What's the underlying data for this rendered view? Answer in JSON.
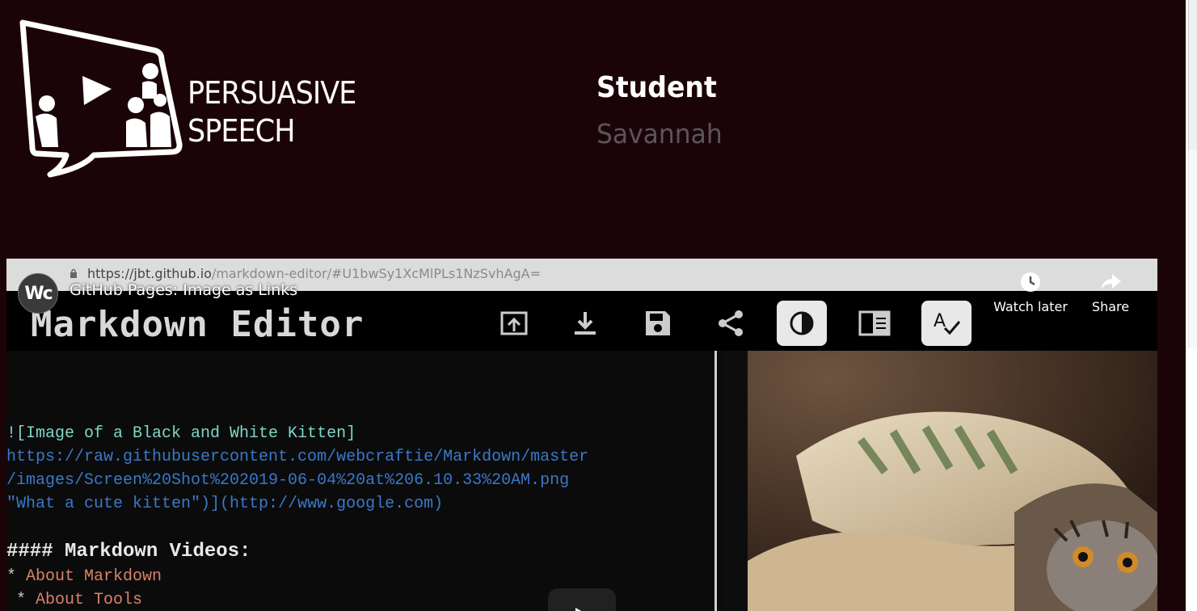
{
  "header": {
    "title_line1": "PERSUASIVE",
    "title_line2": "SPEECH",
    "student_label": "Student",
    "student_name": "Savannah"
  },
  "video": {
    "url_domain": "https://jbt.github.io",
    "url_path": "/markdown-editor/#U1bwSy1XcMlPLs1NzSvhAgA=",
    "channel_initials": "Wc",
    "title": "GitHub Pages: Image as Links",
    "actions": [
      {
        "label": "Watch later",
        "icon": "clock-icon"
      },
      {
        "label": "Share",
        "icon": "share-icon"
      }
    ],
    "editor_title": "Markdown Editor",
    "toolbar_icons": [
      "open-icon",
      "download-icon",
      "save-icon",
      "share-nodes-icon",
      "contrast-icon",
      "preview-toggle-icon",
      "spellcheck-icon"
    ],
    "code_lines": [
      "![Image of a Black and White Kitten]",
      "https://raw.githubusercontent.com/webcraftie/Markdown/master",
      "/images/Screen%20Shot%202019-06-04%20at%206.10.33%20AM.png",
      "\"What a cute kitten\")](http://www.google.com)",
      "#### Markdown Videos:",
      "* About Markdown",
      "  * About Tools"
    ],
    "code_line4_a": "\"What a cute kitten\")",
    "code_line4_b": "](http://www.google.com)",
    "heading_hash": "####",
    "heading_text": " Markdown Videos:",
    "item1_star": "* ",
    "item1_text": "About Markdown",
    "item2_star": " * ",
    "item2_text": "About Tools"
  },
  "colors": {
    "background": "#1b0408",
    "student_name": "#5b545c"
  }
}
